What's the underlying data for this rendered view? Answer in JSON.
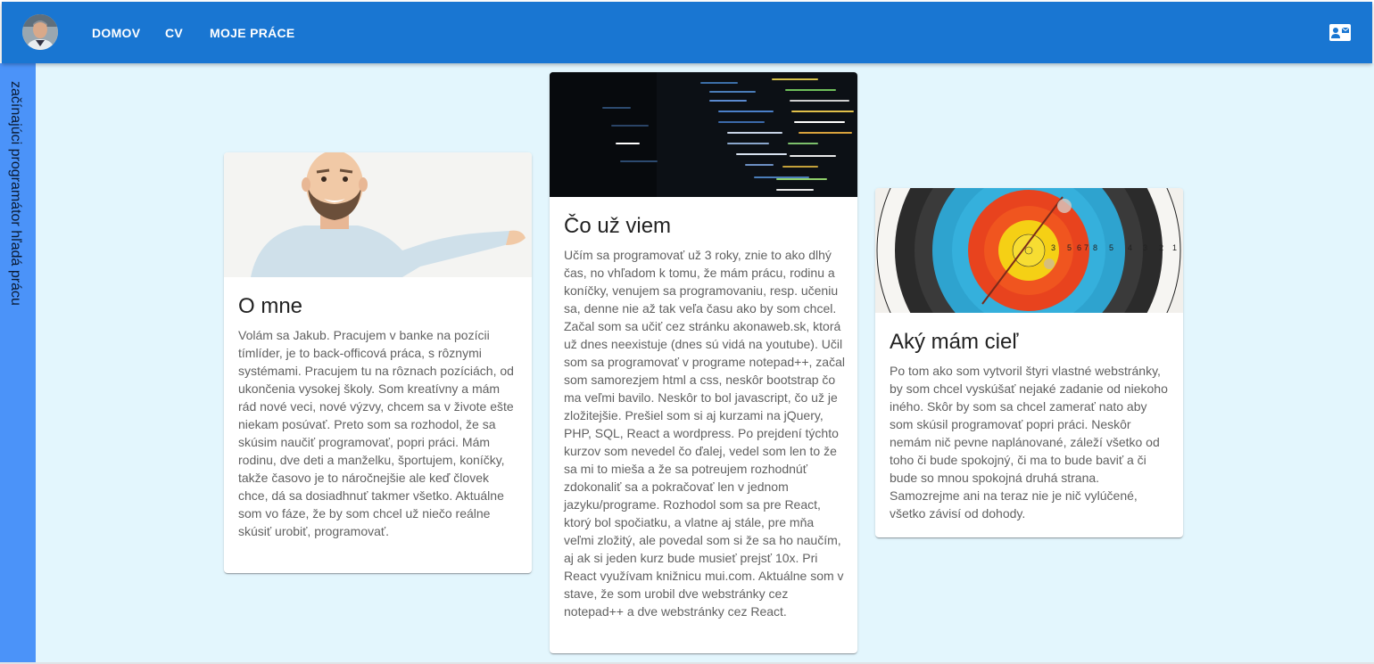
{
  "header": {
    "nav": [
      "DOMOV",
      "CV",
      "MOJE PRÁCE"
    ],
    "contact_icon": "contact-mail-icon",
    "color": "#1976d2"
  },
  "sidebar": {
    "text": "začínajúci programátor hľadá prácu",
    "color": "#4b93f9"
  },
  "cards": [
    {
      "title": "O mne",
      "image": "man-presenting-illustration",
      "text": "Volám sa Jakub. Pracujem v banke na pozícii tímlíder, je to back-officová práca, s rôznymi systémami. Pracujem tu na rôznach pozíciách, od ukončenia vysokej školy. Som kreatívny a mám rád nové veci, nové výzvy, chcem sa v živote ešte niekam posúvať. Preto som sa rozhodol, že sa skúsim naučiť programovať, popri práci. Mám rodinu, dve deti a manželku, športujem, koníčky, takže časovo je to náročnejšie ale keď človek chce, dá sa dosiadhnuť takmer všetko. Aktuálne som vo fáze, že by som chcel už niečo reálne skúsiť urobiť, programovať."
    },
    {
      "title": "Čo už viem",
      "image": "code-screen-photo",
      "text": "Učím sa programovať už 3 roky, znie to ako dlhý čas, no vhľadom k tomu, že mám prácu, rodinu a koníčky, venujem sa programovaniu, resp. učeniu sa, denne nie až tak veľa času ako by som chcel. Začal som sa učiť cez stránku akonaweb.sk, ktorá už dnes neexistuje (dnes sú vidá na youtube). Učil som sa programovať v programe notepad++, začal som samorezjem html a css, neskôr bootstrap čo ma veľmi bavilo. Neskôr to bol javascript, čo už je zložitejšie. Prešiel som si aj kurzami na jQuery, PHP, SQL, React a wordpress. Po prejdení týchto kurzov som nevedel čo ďalej, vedel som len to že sa mi to mieša a že sa potreujem rozhodnúť zdokonaliť sa a pokračovať len v jednom jazyku/programe. Rozhodol som sa pre React, ktorý bol spočiatku, a vlatne aj stále, pre mňa veľmi zložitý, ale povedal som si že sa ho naučím, aj ak si jeden kurz bude musieť prejsť 10x. Pri React využívam knižnicu mui.com. Aktuálne som v stave, že som urobil dve webstránky cez notepad++ a dve webstránky cez React."
    },
    {
      "title": "Aký mám cieľ",
      "image": "archery-target-photo",
      "text": "Po tom ako som vytvoril štyri vlastné webstránky, by som chcel vyskúšať nejaké zadanie od niekoho iného. Skôr by som sa chcel zamerať nato aby som skúsil programovať popri práci. Neskôr nemám nič pevne naplánované, záleží všetko od toho či bude spokojný, či ma to bude baviť a či bude so mnou spokojná druhá strana. Samozrejme ani na teraz nie je nič vylúčené, všetko závisí od dohody."
    }
  ],
  "target_rings": [
    "3",
    "5",
    "6",
    "7",
    "8",
    "5",
    "4",
    "3",
    "2",
    "1"
  ]
}
